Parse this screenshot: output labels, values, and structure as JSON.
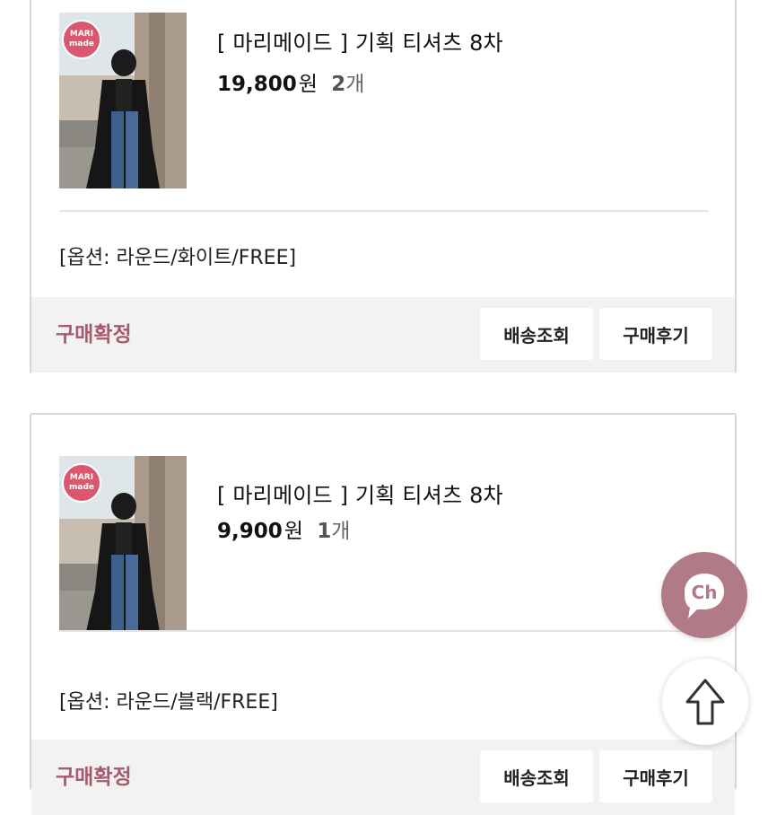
{
  "orders": [
    {
      "badge": "MARI made",
      "title": "[ 마리메이드 ] 기획 티셔츠 8차",
      "price": "19,800",
      "currency": "원",
      "qty": "2",
      "qty_unit": "개",
      "option": "[옵션: 라운드/화이트/FREE]",
      "status": "구매확정",
      "track_label": "배송조회",
      "review_label": "구매후기"
    },
    {
      "badge": "MARI made",
      "title": "[ 마리메이드 ] 기획 티셔츠 8차",
      "price": "9,900",
      "currency": "원",
      "qty": "1",
      "qty_unit": "개",
      "option": "[옵션: 라운드/블랙/FREE]",
      "status": "구매확정",
      "track_label": "배송조회",
      "review_label": "구매후기"
    }
  ],
  "chat_button": {
    "label": "Ch",
    "icon": "chat-bubble-icon"
  },
  "scroll_top_button": {
    "icon": "arrow-up-icon"
  },
  "colors": {
    "status": "#a85a6d",
    "chat_fab": "#b07a86",
    "action_bar": "#f2f2f2",
    "badge": "#d9576f"
  }
}
